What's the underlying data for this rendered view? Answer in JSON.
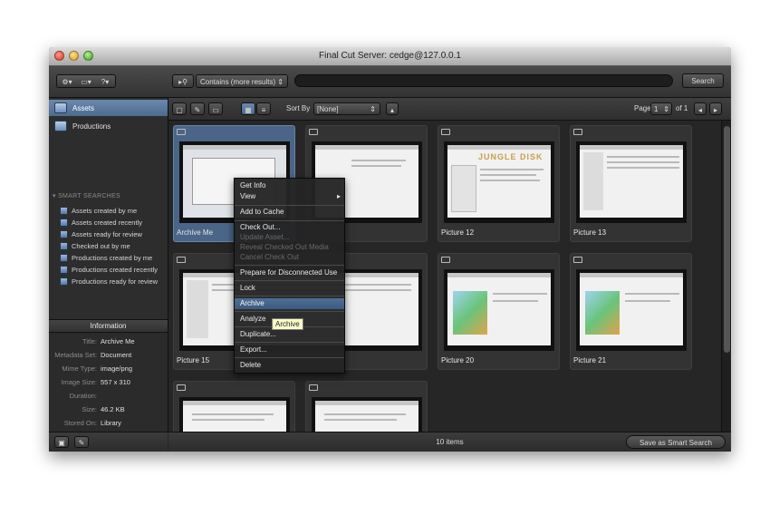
{
  "window": {
    "title": "Final Cut Server: cedge@127.0.0.1"
  },
  "toolbar": {
    "search_mode": "Contains (more results)",
    "search_value": "",
    "search_button": "Search"
  },
  "sidebar": {
    "items": [
      {
        "label": "Assets"
      },
      {
        "label": "Productions"
      }
    ],
    "section_title": "SMART SEARCHES",
    "smart_searches": [
      {
        "label": "Assets created by me"
      },
      {
        "label": "Assets created recently"
      },
      {
        "label": "Assets ready for review"
      },
      {
        "label": "Checked out by me"
      },
      {
        "label": "Productions created by me"
      },
      {
        "label": "Productions created recently"
      },
      {
        "label": "Productions ready for review"
      }
    ]
  },
  "info": {
    "header": "Information",
    "rows": [
      {
        "key": "Title:",
        "value": "Archive Me"
      },
      {
        "key": "Metadata Set:",
        "value": "Document"
      },
      {
        "key": "Mime Type:",
        "value": "image/png"
      },
      {
        "key": "Image Size:",
        "value": "557 x 310"
      },
      {
        "key": "Duration:",
        "value": ""
      },
      {
        "key": "Size:",
        "value": "46.2 KB"
      },
      {
        "key": "Stored On:",
        "value": "Library"
      }
    ]
  },
  "content_bar": {
    "sort_by_label": "Sort By",
    "sort_by_value": "[None]",
    "page_label": "Page",
    "page_value": "1",
    "page_total": "of 1"
  },
  "tiles": [
    {
      "label": "Archive Me",
      "selected": true
    },
    {
      "label": ""
    },
    {
      "label": "Picture 12"
    },
    {
      "label": "Picture 13"
    },
    {
      "label": ""
    },
    {
      "label": "Picture 15"
    },
    {
      "label": "Picture 20"
    },
    {
      "label": "Picture 21"
    },
    {
      "label": ""
    },
    {
      "label": ""
    }
  ],
  "thumb_text": {
    "jungle_disk": "JUNGLE DISK"
  },
  "context_menu": {
    "items": [
      {
        "label": "Get Info",
        "enabled": true
      },
      {
        "label": "View",
        "enabled": true,
        "submenu": true
      },
      {
        "label": "Add to Cache",
        "enabled": true
      },
      {
        "label": "Check Out...",
        "enabled": true
      },
      {
        "label": "Update Asset...",
        "enabled": false
      },
      {
        "label": "Reveal Checked Out Media",
        "enabled": false
      },
      {
        "label": "Cancel Check Out",
        "enabled": false
      },
      {
        "label": "Prepare for Disconnected Use",
        "enabled": true
      },
      {
        "label": "Lock",
        "enabled": true
      },
      {
        "label": "Archive",
        "enabled": true,
        "highlighted": true
      },
      {
        "label": "Analyze",
        "enabled": true
      },
      {
        "label": "Duplicate...",
        "enabled": true
      },
      {
        "label": "Export...",
        "enabled": true
      },
      {
        "label": "Delete",
        "enabled": true
      }
    ],
    "tooltip": "Archive"
  },
  "status": {
    "item_count": "10 items",
    "save_smart_search": "Save as Smart Search"
  },
  "colors": {
    "selection": "#4c6b8f",
    "tooltip_bg": "#fbfbc8",
    "jungle_disk": "#c8a04a"
  }
}
